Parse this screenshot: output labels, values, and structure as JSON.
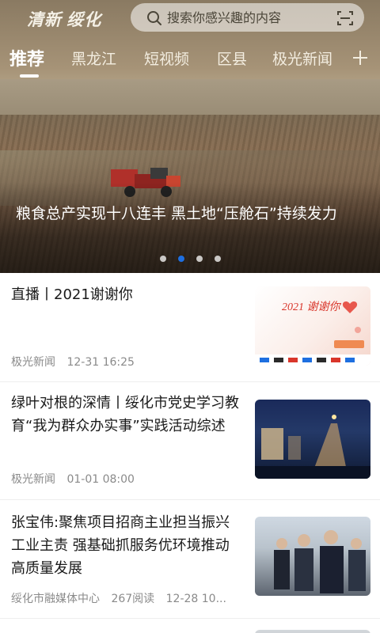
{
  "header": {
    "logo": "清新 绥化",
    "search_placeholder": "搜索你感兴趣的内容",
    "icons": [
      "search-icon",
      "scan-icon",
      "plus-icon"
    ]
  },
  "tabs": [
    {
      "label": "推荐",
      "active": true
    },
    {
      "label": "黑龙江",
      "active": false
    },
    {
      "label": "短视频",
      "active": false
    },
    {
      "label": "区县",
      "active": false
    },
    {
      "label": "极光新闻",
      "active": false
    }
  ],
  "hero": {
    "title": "粮食总产实现十八连丰 黑土地“压舱石”持续发力",
    "slide_count": 4,
    "active_slide": 2
  },
  "feed": [
    {
      "title": "直播丨2021谢谢你",
      "source": "极光新闻",
      "reads": "",
      "time": "12-31 16:25",
      "thumb_text": "2021 谢谢你"
    },
    {
      "title": "绿叶对根的深情丨绥化市党史学习教育“我为群众办实事”实践活动综述",
      "source": "极光新闻",
      "reads": "",
      "time": "01-01 08:00"
    },
    {
      "title": "张宝伟:聚焦项目招商主业担当振兴工业主责 强基础抓服务优环境推动高质量发展",
      "source": "绥化市融媒体中心",
      "reads": "267阅读",
      "time": "12-28 10..."
    }
  ],
  "colors": {
    "accent": "#1e6fe0",
    "text_primary": "#1a1a1a",
    "text_secondary": "#8a8a8a"
  }
}
